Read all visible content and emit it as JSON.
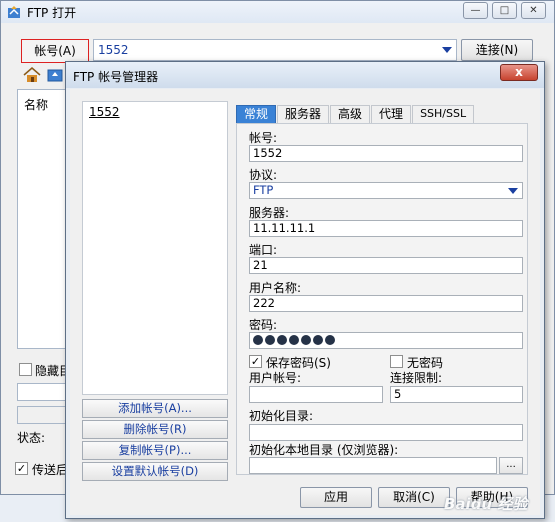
{
  "main_window": {
    "title": "FTP 打开",
    "account_button": "帐号(A)",
    "account_value": "1552",
    "connect_button": "连接(N)",
    "list_column": "名称",
    "hide_checkbox_label": "隐藏目录",
    "status_label": "状态:",
    "send_checkbox_label": "传送后"
  },
  "dialog": {
    "title": "FTP 帐号管理器",
    "close_symbol": "x",
    "account_list": [
      "1552"
    ],
    "left_buttons": {
      "add": "添加帐号(A)...",
      "delete": "删除帐号(R)",
      "copy": "复制帐号(P)...",
      "set_default": "设置默认帐号(D)"
    },
    "tabs": [
      "常规",
      "服务器",
      "高级",
      "代理",
      "SSH/SSL"
    ],
    "active_tab": "常规",
    "form": {
      "account_label": "帐号:",
      "account_value": "1552",
      "protocol_label": "协议:",
      "protocol_value": "FTP",
      "server_label": "服务器:",
      "server_value": "11.11.11.1",
      "port_label": "端口:",
      "port_value": "21",
      "username_label": "用户名称:",
      "username_value": "222",
      "password_label": "密码:",
      "password_length": 7,
      "save_password_label": "保存密码(S)",
      "save_password_checked": true,
      "no_password_label": "无密码",
      "no_password_checked": false,
      "user_account_label": "用户帐号:",
      "user_account_value": "",
      "conn_limit_label": "连接限制:",
      "conn_limit_value": "5",
      "init_dir_label": "初始化目录:",
      "init_dir_value": "",
      "init_local_dir_label": "初始化本地目录 (仅浏览器):",
      "init_local_dir_value": "",
      "browse_label": "..."
    },
    "buttons": {
      "apply": "应用",
      "cancel": "取消(C)",
      "help": "帮助(H)"
    }
  },
  "watermark": "Baidu 经验",
  "colors": {
    "accent_tab": "#3a82d6",
    "link_text": "#1a3fa0",
    "close_button": "#c7432f"
  }
}
